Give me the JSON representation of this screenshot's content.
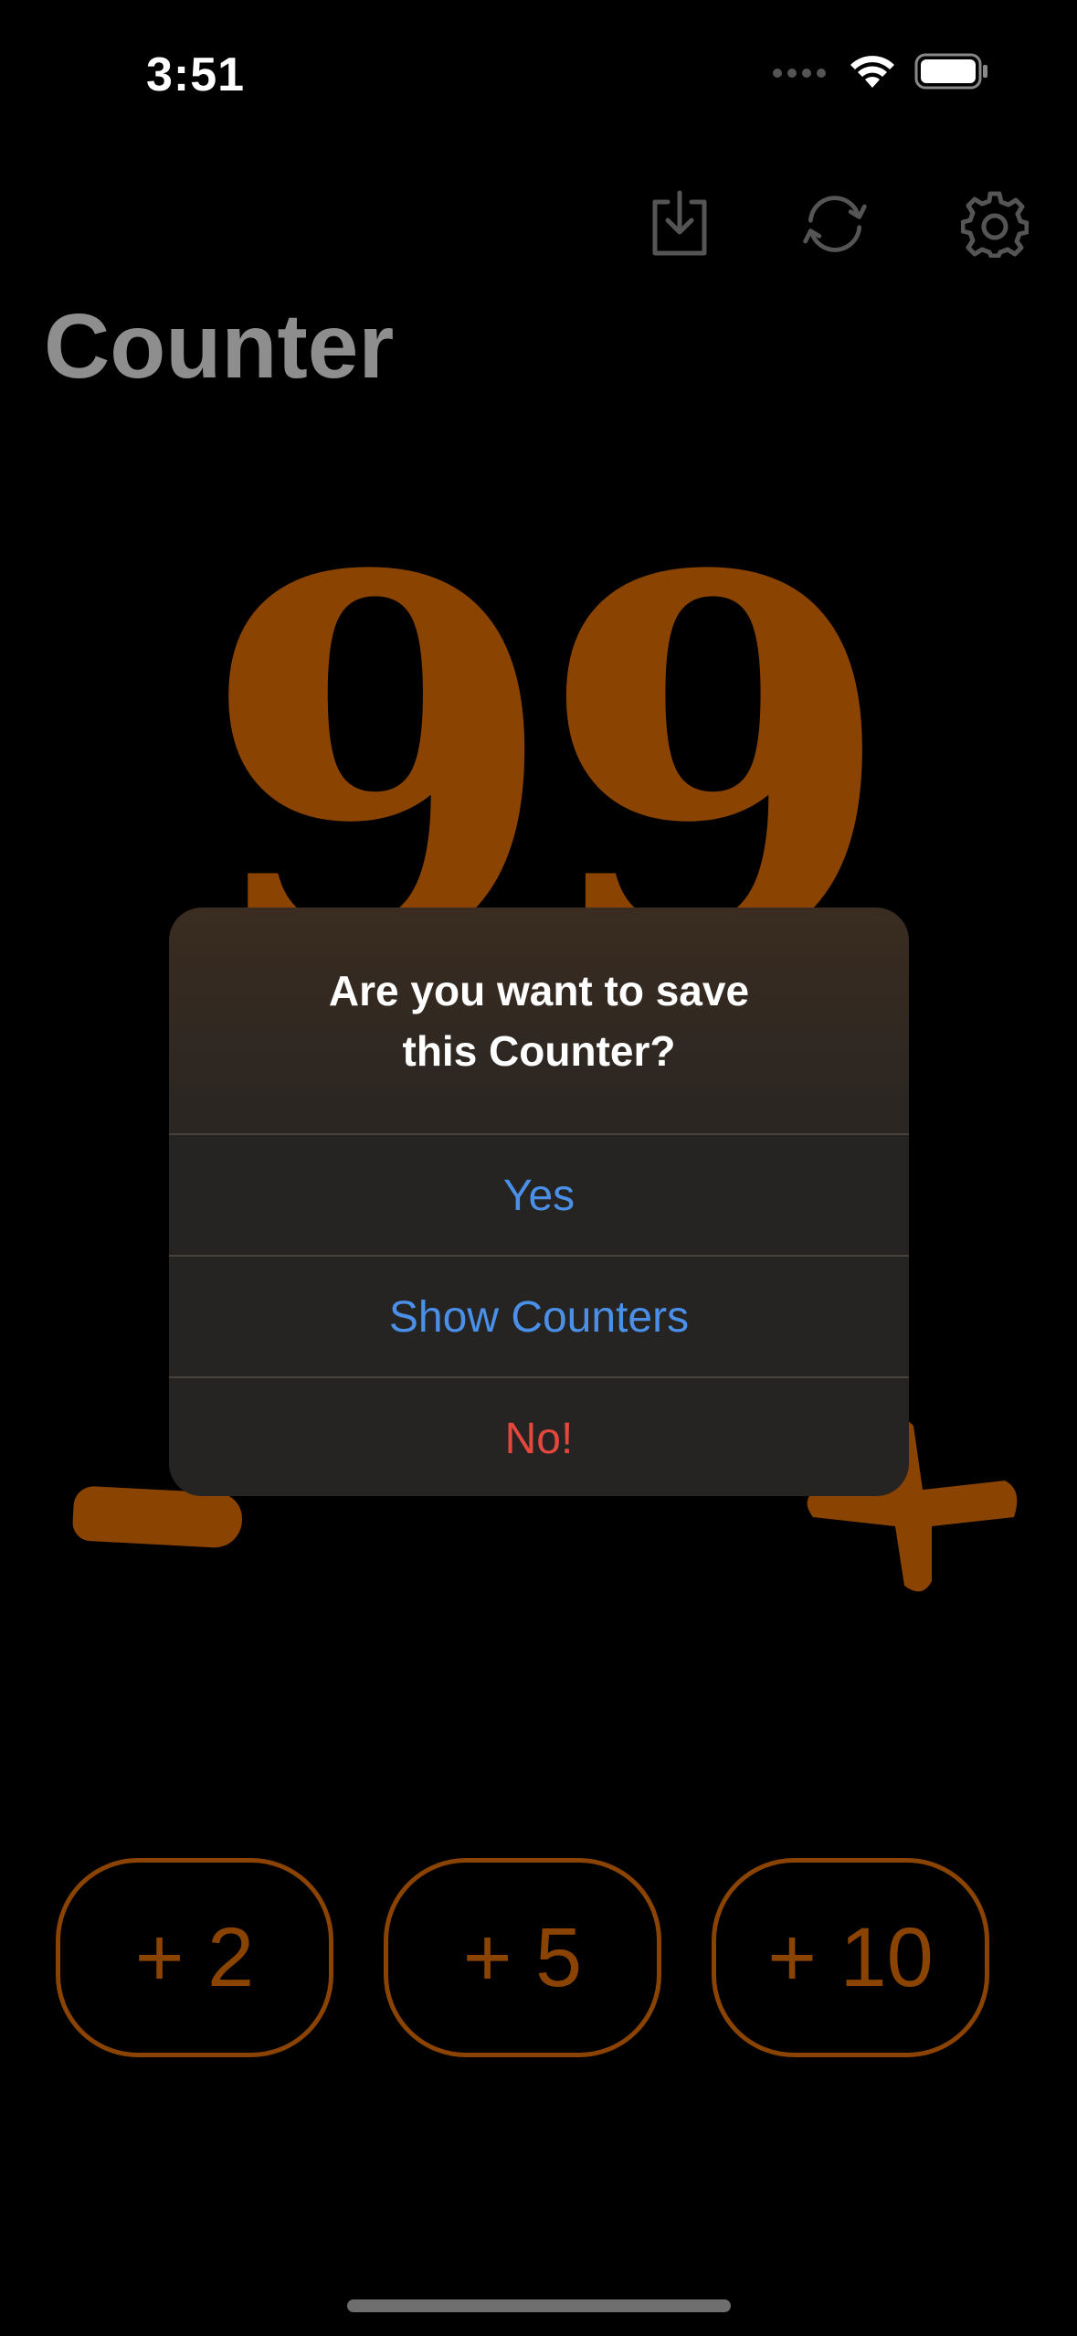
{
  "status_bar": {
    "time": "3:51"
  },
  "toolbar": {
    "icons": [
      "download-icon",
      "refresh-icon",
      "gear-icon"
    ]
  },
  "page": {
    "title": "Counter"
  },
  "counter": {
    "value": "99",
    "color": "#8a4300"
  },
  "dialog": {
    "title": "Are you want to save this Counter?",
    "options": [
      {
        "label": "Yes",
        "color": "#4a90e8"
      },
      {
        "label": "Show Counters",
        "color": "#4a90e8"
      },
      {
        "label": "No!",
        "color": "#e5473d"
      }
    ]
  },
  "increments": [
    {
      "label": "+ 2"
    },
    {
      "label": "+ 5"
    },
    {
      "label": "+ 10"
    }
  ]
}
